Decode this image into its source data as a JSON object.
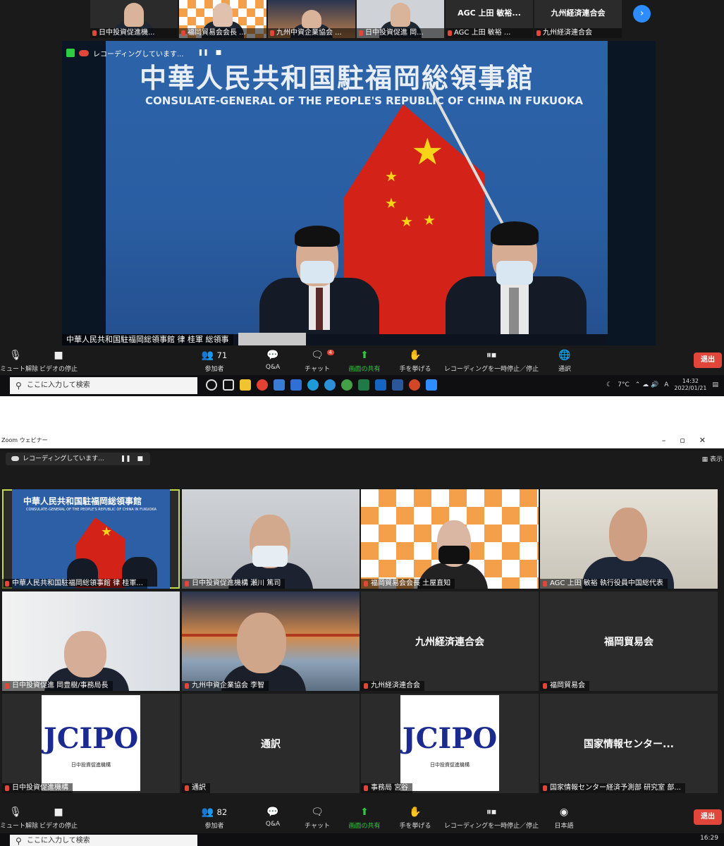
{
  "top": {
    "thumbnails": [
      {
        "label": "日中投資促進機...",
        "type": "person"
      },
      {
        "label": "福岡貿易会会長 ...",
        "type": "checker"
      },
      {
        "label": "九州中資企業協会 ...",
        "type": "bay"
      },
      {
        "label": "日中投資促進 岡...",
        "type": "person"
      },
      {
        "label": "AGC 上田 敏裕 ...",
        "title": "AGC 上田 敏裕...",
        "type": "text"
      },
      {
        "label": "九州経済連合会",
        "title": "九州経済連合会",
        "type": "text"
      }
    ],
    "recording_text": "レコーディングしています...",
    "banner_zh": "中華人民共和国駐福岡総領事館",
    "banner_en": "CONSULATE-GENERAL OF THE PEOPLE'S REPUBLIC OF CHINA IN FUKUOKA",
    "speaker_name": "中華人民共和国駐福岡総領事館 律 桂軍 総領事",
    "toolbar": {
      "unmute": "ミュート解除",
      "stop_video": "ビデオの停止",
      "participants": "参加者",
      "participants_count": "71",
      "qa": "Q&A",
      "chat": "チャット",
      "chat_badge": "4",
      "share": "画面の共有",
      "raise_hand": "手を挙げる",
      "pause_recording": "レコーディングを一時停止／停止",
      "interpretation": "通訳",
      "leave": "退出"
    },
    "taskbar": {
      "search_placeholder": "ここに入力して検索",
      "weather": "7°C",
      "ime": "A",
      "time": "14:32",
      "date": "2022/01/21"
    }
  },
  "bottom": {
    "window_title": "Zoom ウェビナー",
    "recording_text": "レコーディングしています...",
    "view_label": "表示",
    "tiles": [
      {
        "name": "中華人民共和国駐福岡総領事館 律 桂軍...",
        "type": "consulate",
        "active": true
      },
      {
        "name": "日中投資促進機構 瀬川 篤司",
        "type": "office"
      },
      {
        "name": "福岡貿易会会長 土屋直知",
        "type": "checker"
      },
      {
        "name": "AGC 上田 敏裕 執行役員中国総代表",
        "type": "office2"
      },
      {
        "name": "日中投資促進 岡豊樹/事務局長",
        "type": "office"
      },
      {
        "name": "九州中資企業協会 李智",
        "type": "bay"
      },
      {
        "name": "九州経済連合会",
        "center": "九州経済連合会",
        "type": "text"
      },
      {
        "name": "福岡貿易会",
        "center": "福岡貿易会",
        "type": "text"
      },
      {
        "name": "日中投資促進機構",
        "type": "jcipo",
        "logo": "JCIPO",
        "logo_sub": "日中投資促進機構"
      },
      {
        "name": "通訳",
        "center": "通訳",
        "type": "text"
      },
      {
        "name": "事務局 宮谷",
        "type": "jcipo",
        "logo": "JCIPO",
        "logo_sub": "日中投資促進機構"
      },
      {
        "name": "国家情報センター経済予測部 研究室 部...",
        "center": "国家情報センター...",
        "type": "text"
      }
    ],
    "toolbar": {
      "unmute": "ミュート解除",
      "stop_video": "ビデオの停止",
      "participants": "参加者",
      "participants_count": "82",
      "qa": "Q&A",
      "chat": "チャット",
      "share": "画面の共有",
      "raise_hand": "手を挙げる",
      "pause_recording": "レコーディングを一時停止／停止",
      "language": "日本語",
      "leave": "退出"
    },
    "taskbar": {
      "search_placeholder": "ここに入力して検索",
      "time": "16:29"
    }
  }
}
